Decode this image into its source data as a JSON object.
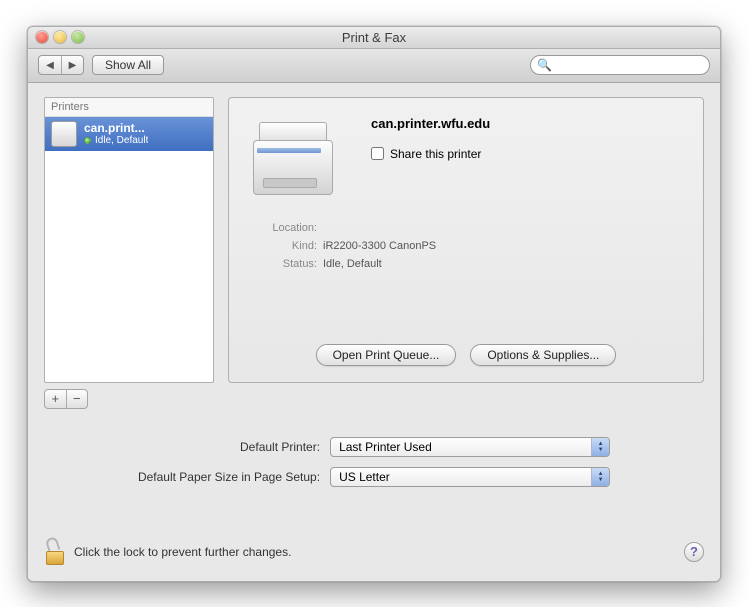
{
  "window": {
    "title": "Print & Fax"
  },
  "toolbar": {
    "show_all": "Show All",
    "search_placeholder": ""
  },
  "sidebar": {
    "header": "Printers",
    "items": [
      {
        "name": "can.print...",
        "status": "Idle, Default"
      }
    ],
    "add_label": "+",
    "remove_label": "−"
  },
  "detail": {
    "title": "can.printer.wfu.edu",
    "share_label": "Share this printer",
    "share_checked": false,
    "location_label": "Location:",
    "location_value": "",
    "kind_label": "Kind:",
    "kind_value": "iR2200-3300 CanonPS",
    "status_label": "Status:",
    "status_value": "Idle, Default",
    "open_queue": "Open Print Queue...",
    "options": "Options & Supplies..."
  },
  "defaults": {
    "printer_label": "Default Printer:",
    "printer_value": "Last Printer Used",
    "paper_label": "Default Paper Size in Page Setup:",
    "paper_value": "US Letter"
  },
  "footer": {
    "lock_text": "Click the lock to prevent further changes.",
    "help": "?"
  }
}
